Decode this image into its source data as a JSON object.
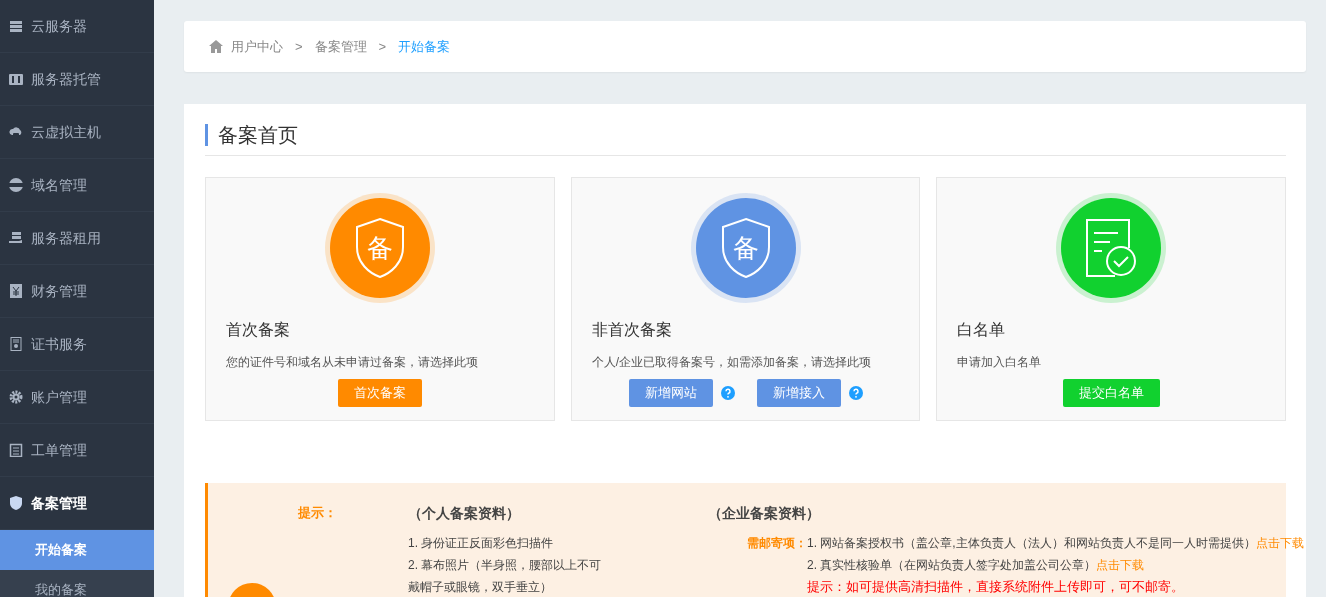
{
  "sidebar": {
    "items": [
      {
        "label": "云服务器",
        "expanded": false
      },
      {
        "label": "服务器托管",
        "expanded": false
      },
      {
        "label": "云虚拟主机",
        "expanded": false
      },
      {
        "label": "域名管理",
        "expanded": false
      },
      {
        "label": "服务器租用",
        "expanded": false
      },
      {
        "label": "财务管理",
        "expanded": false
      },
      {
        "label": "证书服务",
        "expanded": false
      },
      {
        "label": "账户管理",
        "expanded": false
      },
      {
        "label": "工单管理",
        "expanded": false
      },
      {
        "label": "备案管理",
        "expanded": true,
        "children": [
          {
            "label": "开始备案",
            "selected": true
          },
          {
            "label": "我的备案",
            "selected": false
          }
        ]
      }
    ]
  },
  "breadcrumb": [
    {
      "label": "用户中心",
      "current": false
    },
    {
      "label": "备案管理",
      "current": false
    },
    {
      "label": "开始备案",
      "current": true
    }
  ],
  "breadcrumb_separator": ">",
  "page_title": "备案首页",
  "options": [
    {
      "kind": "shield",
      "color": "#ff8a00",
      "title": "首次备案",
      "description": "您的证件号和域名从未申请过备案，请选择此项",
      "glyph": "备",
      "buttons": [
        {
          "label": "首次备案",
          "help": false
        }
      ]
    },
    {
      "kind": "shield",
      "color": "#5f93e3",
      "title": "非首次备案",
      "description": "个人/企业已取得备案号，如需添加备案，请选择此项",
      "glyph": "备",
      "buttons": [
        {
          "label": "新增网站",
          "help": true
        },
        {
          "label": "新增接入",
          "help": true
        }
      ]
    },
    {
      "kind": "document",
      "color": "#11d12f",
      "title": "白名单",
      "description": "申请加入白名单",
      "buttons": [
        {
          "label": "提交白名单",
          "help": false
        }
      ]
    }
  ],
  "notice": {
    "label": "提示：",
    "personal": {
      "heading": "（个人备案资料）",
      "items": [
        "1. 身份证正反面彩色扫描件",
        "2. 幕布照片（半身照，腰部以上不可戴帽子或眼镜，双手垂立）"
      ]
    },
    "enterprise": {
      "heading": "（企业备案资料）",
      "mail_label": "需邮寄项：",
      "items": [
        {
          "text": "1. 网站备案授权书（盖公章,主体负责人（法人）和网站负责人不是同一人时需提供）",
          "link": "点击下载"
        },
        {
          "text": "2. 真实性核验单（在网站负责人签字处加盖公司公章）",
          "link": "点击下载"
        }
      ],
      "note": "提示：如可提供高清扫描件，直接系统附件上传即可，可不邮寄。"
    }
  }
}
